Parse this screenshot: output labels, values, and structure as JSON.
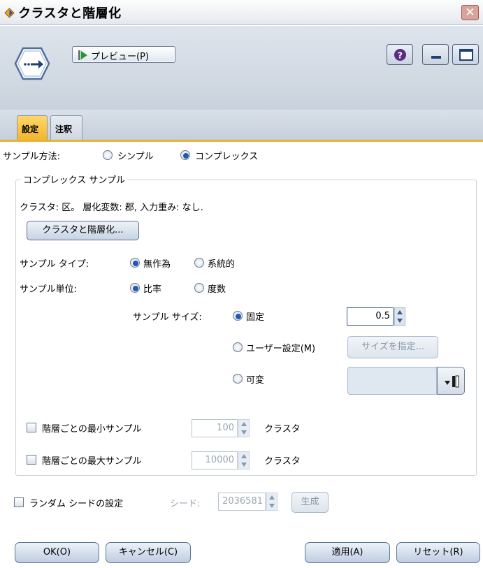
{
  "window": {
    "title": "クラスタと階層化",
    "close_glyph": "✕"
  },
  "toolbar": {
    "preview_label": "プレビュー(P)",
    "help_glyph": "?",
    "icons": [
      "diamond-node-icon",
      "arrow-node-icon",
      "play-icon",
      "help-icon",
      "minimize-icon",
      "maximize-icon"
    ]
  },
  "tabs": [
    {
      "label": "設定",
      "active": true
    },
    {
      "label": "注釈",
      "active": false
    }
  ],
  "settings": {
    "sample_method_label": "サンプル方法:",
    "sample_method_options": [
      {
        "label": "シンプル",
        "selected": false
      },
      {
        "label": "コンプレックス",
        "selected": true
      }
    ],
    "complex_group": {
      "legend": "コンプレックス サンプル",
      "summary": "クラスタ: 区。 層化変数: 郡, 入力重み: なし.",
      "cluster_button": "クラスタと階層化...",
      "sample_type_label": "サンプル タイプ:",
      "sample_type_options": [
        {
          "label": "無作為",
          "selected": true
        },
        {
          "label": "系統的",
          "selected": false
        }
      ],
      "sample_unit_label": "サンプル単位:",
      "sample_unit_options": [
        {
          "label": "比率",
          "selected": true
        },
        {
          "label": "度数",
          "selected": false
        }
      ],
      "sample_size_label": "サンプル サイズ:",
      "size_fixed_label": "固定",
      "size_fixed_value": "0.5",
      "size_custom_label": "ユーザー設定(M)",
      "size_specify_button": "サイズを指定...",
      "size_variable_label": "可変",
      "min_per_stratum": {
        "label": "階層ごとの最小サンプル",
        "value": "100",
        "unit": "クラスタ",
        "checked": false
      },
      "max_per_stratum": {
        "label": "階層ごとの最大サンプル",
        "value": "10000",
        "unit": "クラスタ",
        "checked": false
      }
    },
    "random_seed": {
      "label": "ランダム シードの設定",
      "seed_label": "シード:",
      "seed_value": "2036581",
      "generate_button": "生成",
      "checked": false
    }
  },
  "buttons": {
    "ok": "OK(O)",
    "cancel": "キャンセル(C)",
    "apply": "適用(A)",
    "reset": "リセット(R)"
  },
  "colors": {
    "accent_tab": "#f3b62b",
    "header_bg": "#c9d2dd",
    "radio_selected": "#1f59b8"
  }
}
